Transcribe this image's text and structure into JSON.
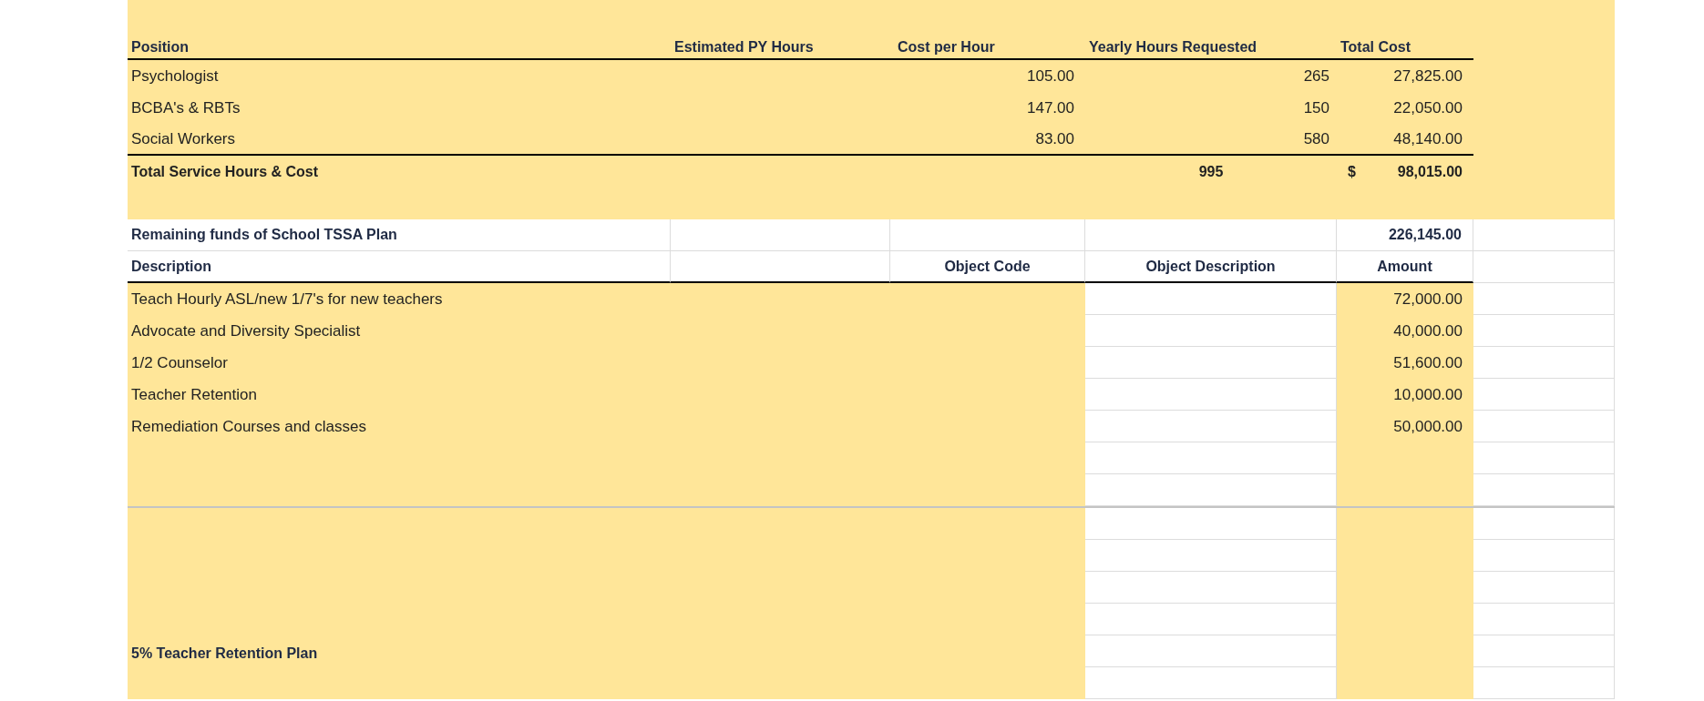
{
  "services": {
    "headers": {
      "position": "Position",
      "estimated_py_hours": "Estimated PY Hours",
      "cost_per_hour": "Cost per Hour",
      "yearly_hours_requested": "Yearly Hours Requested",
      "total_cost": "Total Cost"
    },
    "rows": [
      {
        "position": "Psychologist",
        "cost_per_hour": "105.00",
        "yearly_hours_requested": "265",
        "total_cost": "27,825.00"
      },
      {
        "position": "BCBA's & RBTs",
        "cost_per_hour": "147.00",
        "yearly_hours_requested": "150",
        "total_cost": "22,050.00"
      },
      {
        "position": "Social Workers",
        "cost_per_hour": "83.00",
        "yearly_hours_requested": "580",
        "total_cost": "48,140.00"
      }
    ],
    "total": {
      "label": "Total Service Hours & Cost",
      "yearly_hours_requested": "995",
      "currency": "$",
      "total_cost": "98,015.00"
    }
  },
  "remaining_funds": {
    "label": "Remaining funds of School TSSA Plan",
    "amount": "226,145.00"
  },
  "expenses": {
    "headers": {
      "description": "Description",
      "object_code": "Object Code",
      "object_description": "Object Description",
      "amount": "Amount"
    },
    "rows": [
      {
        "description": "Teach Hourly ASL/new 1/7's for new teachers",
        "amount": "72,000.00"
      },
      {
        "description": "Advocate and Diversity Specialist",
        "amount": "40,000.00"
      },
      {
        "description": "1/2 Counselor",
        "amount": "51,600.00"
      },
      {
        "description": "Teacher Retention",
        "amount": "10,000.00"
      },
      {
        "description": "Remediation Courses and classes",
        "amount": "50,000.00"
      }
    ]
  },
  "retention_plan": {
    "label": "5% Teacher Retention Plan"
  }
}
